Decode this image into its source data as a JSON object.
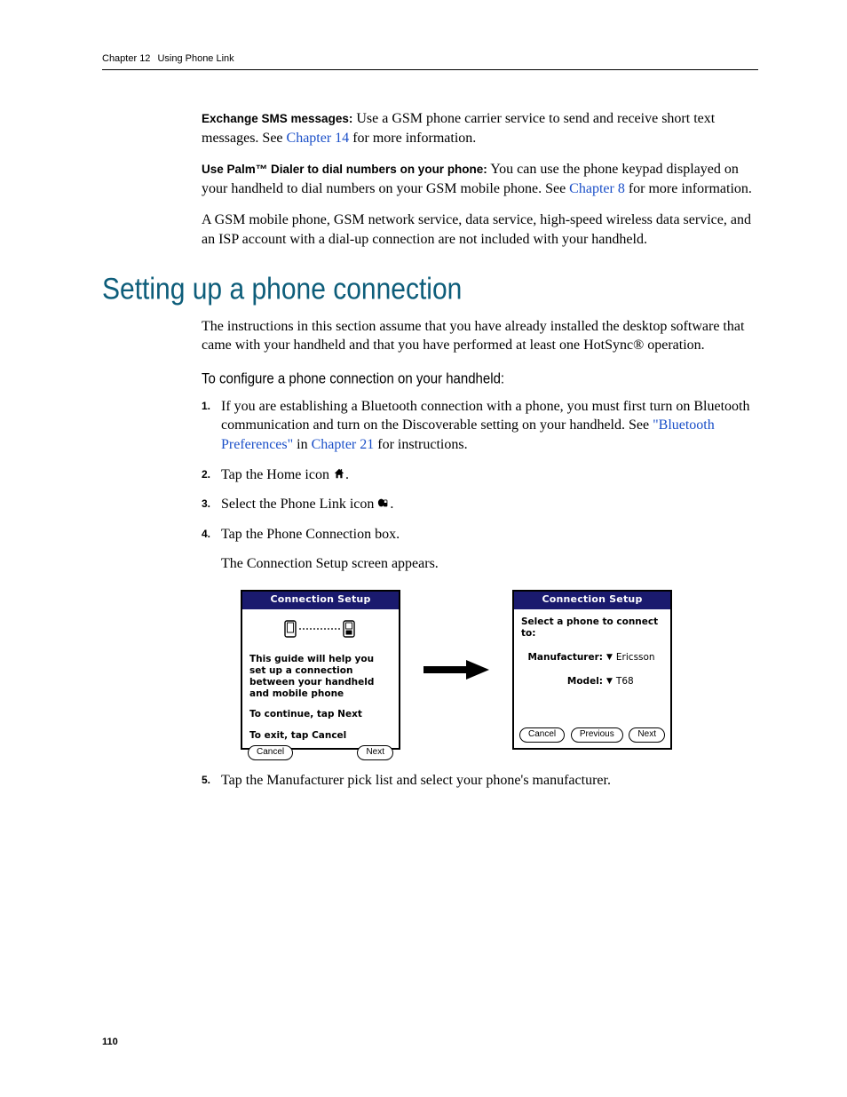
{
  "header": {
    "chapter_label": "Chapter 12",
    "chapter_title": "Using Phone Link"
  },
  "page_number": "110",
  "para_sms": {
    "bold": "Exchange SMS messages:",
    "before_link": " Use a GSM phone carrier service to send and receive short text messages. See ",
    "link": "Chapter 14",
    "after_link": " for more information."
  },
  "para_dialer": {
    "bold": "Use Palm™ Dialer to dial numbers on your phone:",
    "before_link": " You can use the phone keypad displayed on your handheld to dial numbers on your GSM mobile phone. See ",
    "link": "Chapter 8",
    "after_link": " for more information."
  },
  "para_gsm": "A GSM mobile phone, GSM network service, data service, high-speed wireless data service, and an ISP account with a dial-up connection are not included with your handheld.",
  "heading_setup": "Setting up a phone connection",
  "para_intro": "The instructions in this section assume that you have already installed the desktop software that came with your handheld and that you have performed at least one HotSync® operation.",
  "subhead_configure": "To configure a phone connection on your handheld:",
  "steps": [
    {
      "num": "1.",
      "text_before": "If you are establishing a Bluetooth connection with a phone, you must first turn on Bluetooth communication and turn on the Discoverable setting on your handheld. See ",
      "link1": "\"Bluetooth Preferences\"",
      "mid": " in ",
      "link2": "Chapter 21",
      "text_after": " for instructions."
    },
    {
      "num": "2.",
      "text": "Tap the Home icon ",
      "after": "."
    },
    {
      "num": "3.",
      "text": "Select the Phone Link icon ",
      "after": "."
    },
    {
      "num": "4.",
      "text": "Tap the Phone Connection box.",
      "sub": "The Connection Setup screen appears."
    },
    {
      "num": "5.",
      "text": "Tap the Manufacturer pick list and select your phone's manufacturer."
    }
  ],
  "palm_screens": {
    "left": {
      "title": "Connection Setup",
      "body1": "This guide will help you set up a connection between your handheld and mobile phone",
      "body2": "To continue, tap Next",
      "body3": "To exit, tap Cancel",
      "buttons": {
        "cancel": "Cancel",
        "next": "Next"
      }
    },
    "right": {
      "title": "Connection Setup",
      "prompt": "Select a phone to connect to:",
      "manufacturer_label": "Manufacturer:",
      "manufacturer_value": "Ericsson",
      "model_label": "Model:",
      "model_value": "T68",
      "buttons": {
        "cancel": "Cancel",
        "previous": "Previous",
        "next": "Next"
      }
    }
  }
}
